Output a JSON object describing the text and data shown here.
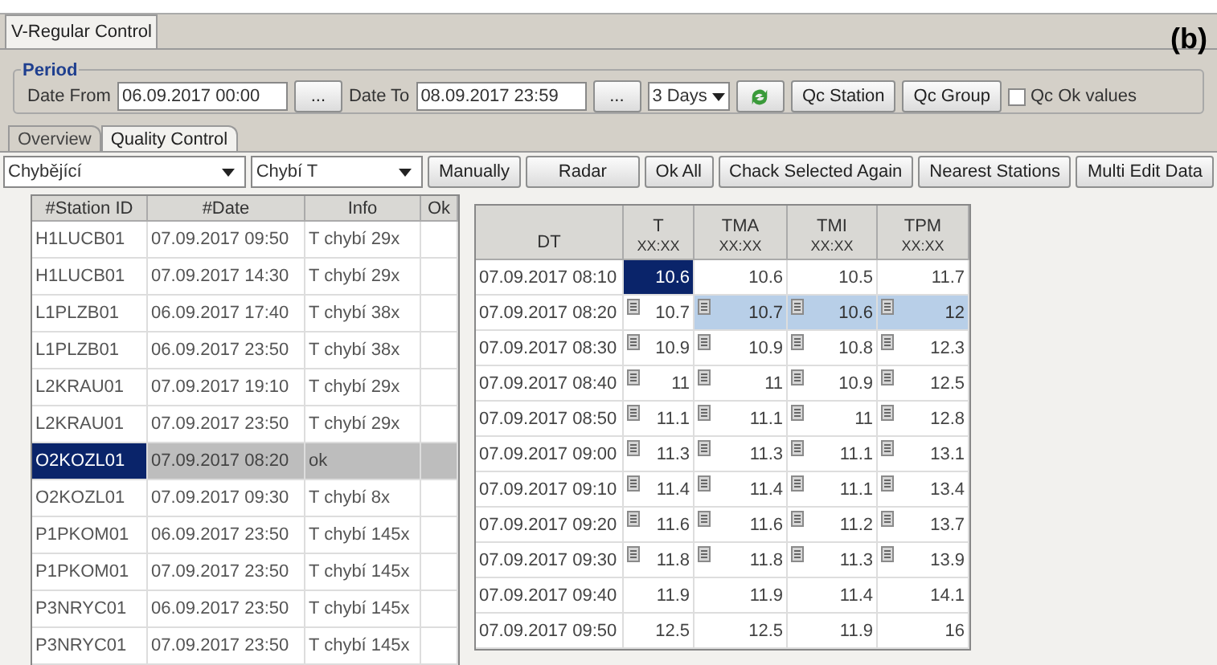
{
  "window_tab": {
    "label": "V-Regular Control",
    "selected": true
  },
  "figure_label": "(b)",
  "period": {
    "title": "Period",
    "date_from_label": "Date From",
    "date_from": "06.09.2017 00:00",
    "browse_from": "...",
    "date_to_label": "Date To",
    "date_to": "08.09.2017 23:59",
    "browse_to": "...",
    "range": "3 Days",
    "buttons": [
      "Qc Station",
      "Qc Group"
    ],
    "qc_ok": {
      "label": "Qc Ok values",
      "checked": false
    }
  },
  "tabs": [
    {
      "label": "Overview",
      "selected": false
    },
    {
      "label": "Quality Control",
      "selected": true
    }
  ],
  "toolbar": {
    "filter_1": "Chybějící",
    "filter_2": "Chybí T",
    "buttons": [
      "Manually",
      "Radar",
      "Ok All",
      "Chack Selected Again",
      "Nearest Stations",
      "Multi Edit Data"
    ]
  },
  "stations": {
    "columns": [
      "#Station ID",
      "#Date",
      "Info",
      "Ok"
    ],
    "rows": [
      {
        "cells": [
          "H1LUCB01",
          "07.09.2017 09:50",
          "T chybí 29x",
          ""
        ],
        "selected": false
      },
      {
        "cells": [
          "H1LUCB01",
          "07.09.2017 14:30",
          "T chybí 29x",
          ""
        ],
        "selected": false
      },
      {
        "cells": [
          "L1PLZB01",
          "06.09.2017 17:40",
          "T chybí 38x",
          ""
        ],
        "selected": false
      },
      {
        "cells": [
          "L1PLZB01",
          "06.09.2017 23:50",
          "T chybí 38x",
          ""
        ],
        "selected": false
      },
      {
        "cells": [
          "L2KRAU01",
          "07.09.2017 19:10",
          "T chybí 29x",
          ""
        ],
        "selected": false
      },
      {
        "cells": [
          "L2KRAU01",
          "07.09.2017 23:50",
          "T chybí 29x",
          ""
        ],
        "selected": false
      },
      {
        "cells": [
          "O2KOZL01",
          "07.09.2017 08:20",
          "ok",
          ""
        ],
        "selected": true
      },
      {
        "cells": [
          "O2KOZL01",
          "07.09.2017 09:30",
          "T chybí 8x",
          ""
        ],
        "selected": false
      },
      {
        "cells": [
          "P1PKOM01",
          "06.09.2017 23:50",
          "T chybí 145x",
          ""
        ],
        "selected": false
      },
      {
        "cells": [
          "P1PKOM01",
          "07.09.2017 23:50",
          "T chybí 145x",
          ""
        ],
        "selected": false
      },
      {
        "cells": [
          "P3NRYC01",
          "06.09.2017 23:50",
          "T chybí 145x",
          ""
        ],
        "selected": false
      },
      {
        "cells": [
          "P3NRYC01",
          "07.09.2017 23:50",
          "T chybí 145x",
          ""
        ],
        "selected": false
      }
    ]
  },
  "data": {
    "row_header": "DT",
    "columns": [
      {
        "name": "T",
        "unit": "XX:XX"
      },
      {
        "name": "TMA",
        "unit": "XX:XX"
      },
      {
        "name": "TMI",
        "unit": "XX:XX"
      },
      {
        "name": "TPM",
        "unit": "XX:XX"
      }
    ],
    "rows": [
      {
        "dt": "07.09.2017 08:10",
        "cells": [
          {
            "value": "10.6",
            "note": false,
            "selected": true,
            "highlighted": false
          },
          {
            "value": "10.6",
            "note": false,
            "selected": false,
            "highlighted": false
          },
          {
            "value": "10.5",
            "note": false,
            "selected": false,
            "highlighted": false
          },
          {
            "value": "11.7",
            "note": false,
            "selected": false,
            "highlighted": false
          }
        ]
      },
      {
        "dt": "07.09.2017 08:20",
        "cells": [
          {
            "value": "10.7",
            "note": true,
            "selected": false,
            "highlighted": false
          },
          {
            "value": "10.7",
            "note": true,
            "selected": false,
            "highlighted": true
          },
          {
            "value": "10.6",
            "note": true,
            "selected": false,
            "highlighted": true
          },
          {
            "value": "12",
            "note": true,
            "selected": false,
            "highlighted": true
          }
        ]
      },
      {
        "dt": "07.09.2017 08:30",
        "cells": [
          {
            "value": "10.9",
            "note": true,
            "selected": false,
            "highlighted": false
          },
          {
            "value": "10.9",
            "note": true,
            "selected": false,
            "highlighted": false
          },
          {
            "value": "10.8",
            "note": true,
            "selected": false,
            "highlighted": false
          },
          {
            "value": "12.3",
            "note": true,
            "selected": false,
            "highlighted": false
          }
        ]
      },
      {
        "dt": "07.09.2017 08:40",
        "cells": [
          {
            "value": "11",
            "note": true,
            "selected": false,
            "highlighted": false
          },
          {
            "value": "11",
            "note": true,
            "selected": false,
            "highlighted": false
          },
          {
            "value": "10.9",
            "note": true,
            "selected": false,
            "highlighted": false
          },
          {
            "value": "12.5",
            "note": true,
            "selected": false,
            "highlighted": false
          }
        ]
      },
      {
        "dt": "07.09.2017 08:50",
        "cells": [
          {
            "value": "11.1",
            "note": true,
            "selected": false,
            "highlighted": false
          },
          {
            "value": "11.1",
            "note": true,
            "selected": false,
            "highlighted": false
          },
          {
            "value": "11",
            "note": true,
            "selected": false,
            "highlighted": false
          },
          {
            "value": "12.8",
            "note": true,
            "selected": false,
            "highlighted": false
          }
        ]
      },
      {
        "dt": "07.09.2017 09:00",
        "cells": [
          {
            "value": "11.3",
            "note": true,
            "selected": false,
            "highlighted": false
          },
          {
            "value": "11.3",
            "note": true,
            "selected": false,
            "highlighted": false
          },
          {
            "value": "11.1",
            "note": true,
            "selected": false,
            "highlighted": false
          },
          {
            "value": "13.1",
            "note": true,
            "selected": false,
            "highlighted": false
          }
        ]
      },
      {
        "dt": "07.09.2017 09:10",
        "cells": [
          {
            "value": "11.4",
            "note": true,
            "selected": false,
            "highlighted": false
          },
          {
            "value": "11.4",
            "note": true,
            "selected": false,
            "highlighted": false
          },
          {
            "value": "11.1",
            "note": true,
            "selected": false,
            "highlighted": false
          },
          {
            "value": "13.4",
            "note": true,
            "selected": false,
            "highlighted": false
          }
        ]
      },
      {
        "dt": "07.09.2017 09:20",
        "cells": [
          {
            "value": "11.6",
            "note": true,
            "selected": false,
            "highlighted": false
          },
          {
            "value": "11.6",
            "note": true,
            "selected": false,
            "highlighted": false
          },
          {
            "value": "11.2",
            "note": true,
            "selected": false,
            "highlighted": false
          },
          {
            "value": "13.7",
            "note": true,
            "selected": false,
            "highlighted": false
          }
        ]
      },
      {
        "dt": "07.09.2017 09:30",
        "cells": [
          {
            "value": "11.8",
            "note": true,
            "selected": false,
            "highlighted": false
          },
          {
            "value": "11.8",
            "note": true,
            "selected": false,
            "highlighted": false
          },
          {
            "value": "11.3",
            "note": true,
            "selected": false,
            "highlighted": false
          },
          {
            "value": "13.9",
            "note": true,
            "selected": false,
            "highlighted": false
          }
        ]
      },
      {
        "dt": "07.09.2017 09:40",
        "cells": [
          {
            "value": "11.9",
            "note": false,
            "selected": false,
            "highlighted": false
          },
          {
            "value": "11.9",
            "note": false,
            "selected": false,
            "highlighted": false
          },
          {
            "value": "11.4",
            "note": false,
            "selected": false,
            "highlighted": false
          },
          {
            "value": "14.1",
            "note": false,
            "selected": false,
            "highlighted": false
          }
        ]
      },
      {
        "dt": "07.09.2017 09:50",
        "cells": [
          {
            "value": "12.5",
            "note": false,
            "selected": false,
            "highlighted": false
          },
          {
            "value": "12.5",
            "note": false,
            "selected": false,
            "highlighted": false
          },
          {
            "value": "11.9",
            "note": false,
            "selected": false,
            "highlighted": false
          },
          {
            "value": "16",
            "note": false,
            "selected": false,
            "highlighted": false
          }
        ]
      }
    ]
  }
}
